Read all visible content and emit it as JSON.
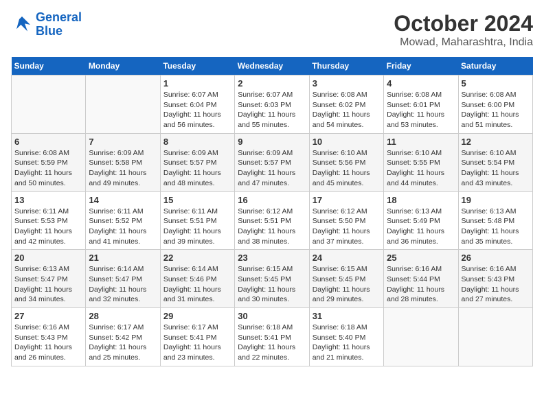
{
  "header": {
    "logo_line1": "General",
    "logo_line2": "Blue",
    "month": "October 2024",
    "location": "Mowad, Maharashtra, India"
  },
  "days_of_week": [
    "Sunday",
    "Monday",
    "Tuesday",
    "Wednesday",
    "Thursday",
    "Friday",
    "Saturday"
  ],
  "weeks": [
    [
      {
        "day": "",
        "info": ""
      },
      {
        "day": "",
        "info": ""
      },
      {
        "day": "1",
        "info": "Sunrise: 6:07 AM\nSunset: 6:04 PM\nDaylight: 11 hours\nand 56 minutes."
      },
      {
        "day": "2",
        "info": "Sunrise: 6:07 AM\nSunset: 6:03 PM\nDaylight: 11 hours\nand 55 minutes."
      },
      {
        "day": "3",
        "info": "Sunrise: 6:08 AM\nSunset: 6:02 PM\nDaylight: 11 hours\nand 54 minutes."
      },
      {
        "day": "4",
        "info": "Sunrise: 6:08 AM\nSunset: 6:01 PM\nDaylight: 11 hours\nand 53 minutes."
      },
      {
        "day": "5",
        "info": "Sunrise: 6:08 AM\nSunset: 6:00 PM\nDaylight: 11 hours\nand 51 minutes."
      }
    ],
    [
      {
        "day": "6",
        "info": "Sunrise: 6:08 AM\nSunset: 5:59 PM\nDaylight: 11 hours\nand 50 minutes."
      },
      {
        "day": "7",
        "info": "Sunrise: 6:09 AM\nSunset: 5:58 PM\nDaylight: 11 hours\nand 49 minutes."
      },
      {
        "day": "8",
        "info": "Sunrise: 6:09 AM\nSunset: 5:57 PM\nDaylight: 11 hours\nand 48 minutes."
      },
      {
        "day": "9",
        "info": "Sunrise: 6:09 AM\nSunset: 5:57 PM\nDaylight: 11 hours\nand 47 minutes."
      },
      {
        "day": "10",
        "info": "Sunrise: 6:10 AM\nSunset: 5:56 PM\nDaylight: 11 hours\nand 45 minutes."
      },
      {
        "day": "11",
        "info": "Sunrise: 6:10 AM\nSunset: 5:55 PM\nDaylight: 11 hours\nand 44 minutes."
      },
      {
        "day": "12",
        "info": "Sunrise: 6:10 AM\nSunset: 5:54 PM\nDaylight: 11 hours\nand 43 minutes."
      }
    ],
    [
      {
        "day": "13",
        "info": "Sunrise: 6:11 AM\nSunset: 5:53 PM\nDaylight: 11 hours\nand 42 minutes."
      },
      {
        "day": "14",
        "info": "Sunrise: 6:11 AM\nSunset: 5:52 PM\nDaylight: 11 hours\nand 41 minutes."
      },
      {
        "day": "15",
        "info": "Sunrise: 6:11 AM\nSunset: 5:51 PM\nDaylight: 11 hours\nand 39 minutes."
      },
      {
        "day": "16",
        "info": "Sunrise: 6:12 AM\nSunset: 5:51 PM\nDaylight: 11 hours\nand 38 minutes."
      },
      {
        "day": "17",
        "info": "Sunrise: 6:12 AM\nSunset: 5:50 PM\nDaylight: 11 hours\nand 37 minutes."
      },
      {
        "day": "18",
        "info": "Sunrise: 6:13 AM\nSunset: 5:49 PM\nDaylight: 11 hours\nand 36 minutes."
      },
      {
        "day": "19",
        "info": "Sunrise: 6:13 AM\nSunset: 5:48 PM\nDaylight: 11 hours\nand 35 minutes."
      }
    ],
    [
      {
        "day": "20",
        "info": "Sunrise: 6:13 AM\nSunset: 5:47 PM\nDaylight: 11 hours\nand 34 minutes."
      },
      {
        "day": "21",
        "info": "Sunrise: 6:14 AM\nSunset: 5:47 PM\nDaylight: 11 hours\nand 32 minutes."
      },
      {
        "day": "22",
        "info": "Sunrise: 6:14 AM\nSunset: 5:46 PM\nDaylight: 11 hours\nand 31 minutes."
      },
      {
        "day": "23",
        "info": "Sunrise: 6:15 AM\nSunset: 5:45 PM\nDaylight: 11 hours\nand 30 minutes."
      },
      {
        "day": "24",
        "info": "Sunrise: 6:15 AM\nSunset: 5:45 PM\nDaylight: 11 hours\nand 29 minutes."
      },
      {
        "day": "25",
        "info": "Sunrise: 6:16 AM\nSunset: 5:44 PM\nDaylight: 11 hours\nand 28 minutes."
      },
      {
        "day": "26",
        "info": "Sunrise: 6:16 AM\nSunset: 5:43 PM\nDaylight: 11 hours\nand 27 minutes."
      }
    ],
    [
      {
        "day": "27",
        "info": "Sunrise: 6:16 AM\nSunset: 5:43 PM\nDaylight: 11 hours\nand 26 minutes."
      },
      {
        "day": "28",
        "info": "Sunrise: 6:17 AM\nSunset: 5:42 PM\nDaylight: 11 hours\nand 25 minutes."
      },
      {
        "day": "29",
        "info": "Sunrise: 6:17 AM\nSunset: 5:41 PM\nDaylight: 11 hours\nand 23 minutes."
      },
      {
        "day": "30",
        "info": "Sunrise: 6:18 AM\nSunset: 5:41 PM\nDaylight: 11 hours\nand 22 minutes."
      },
      {
        "day": "31",
        "info": "Sunrise: 6:18 AM\nSunset: 5:40 PM\nDaylight: 11 hours\nand 21 minutes."
      },
      {
        "day": "",
        "info": ""
      },
      {
        "day": "",
        "info": ""
      }
    ]
  ]
}
